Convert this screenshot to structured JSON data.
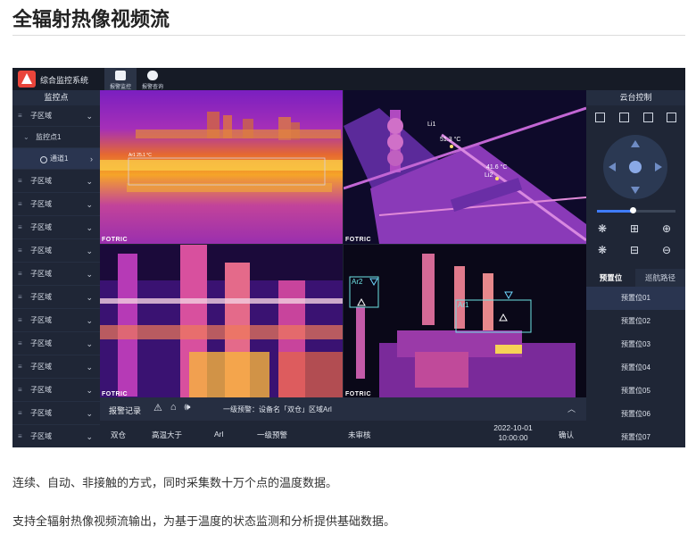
{
  "page": {
    "title": "全辐射热像视频流",
    "paragraph_1": "连续、自动、非接触的方式，同时采集数十万个点的温度数据。",
    "paragraph_2": "支持全辐射热像视频流输出，为基于温度的状态监测和分析提供基础数据。"
  },
  "app": {
    "name": "综合监控系统",
    "nav": [
      {
        "label": "报警监控",
        "icon": "alarm-monitor-icon"
      },
      {
        "label": "报警查询",
        "icon": "alarm-query-icon"
      }
    ]
  },
  "sidebar": {
    "header": "监控点",
    "region_label": "子区域",
    "point_label": "监控点1",
    "channel_label": "通道1",
    "region_count": 12
  },
  "video": {
    "brand": "FOTRIC",
    "tile2_labels": {
      "li1": "Li1",
      "li1_temp": "51.3 °C",
      "li2": "Li2",
      "li2_temp": "41.6 °C"
    },
    "tile4_labels": {
      "ar1": "Ar1",
      "ar2": "Ar2"
    }
  },
  "alarm": {
    "title": "报警记录",
    "message": "一级预警：设备名「双仓」区域Arl",
    "collapse_icon": "chevron-up-icon",
    "row": {
      "device": "双仓",
      "rule": "高温大于",
      "area": "Arl",
      "level": "一级预警",
      "status": "未审核",
      "date": "2022-10-01",
      "time": "10:00:00",
      "action": "确认"
    }
  },
  "ptz": {
    "header": "云台控制",
    "zoom_level": 0.46,
    "tabs": [
      "预置位",
      "巡航路径"
    ],
    "presets": [
      "预置位01",
      "预置位02",
      "预置位03",
      "预置位04",
      "预置位05",
      "预置位06",
      "预置位07"
    ]
  }
}
